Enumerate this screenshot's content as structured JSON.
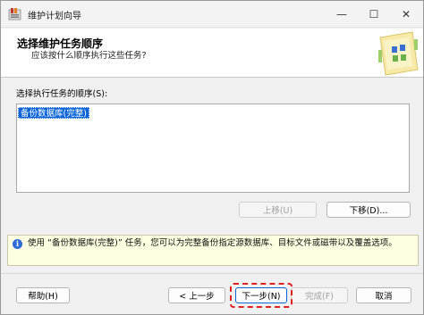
{
  "window": {
    "title": "维护计划向导",
    "minimize_glyph": "—",
    "maximize_glyph": "☐",
    "close_glyph": "✕"
  },
  "header": {
    "title": "选择维护任务顺序",
    "subtitle": "应该按什么顺序执行这些任务?"
  },
  "task_list": {
    "label": "选择执行任务的顺序(S):",
    "items": [
      "备份数据库(完整)"
    ],
    "selected_index": 0
  },
  "order_buttons": {
    "move_up": "上移(U)",
    "move_down": "下移(D)..."
  },
  "hint": {
    "icon": "info-icon",
    "text": "使用 “备份数据库(完整)” 任务，您可以为完整备份指定源数据库、目标文件或磁带以及覆盖选项。"
  },
  "footer": {
    "help": "帮助(H)",
    "back": "< 上一步",
    "next": "下一步(N)",
    "finish": "完成(F)",
    "cancel": "取消"
  },
  "colors": {
    "selection": "#0a64d8",
    "hint_background": "#ffffe1",
    "highlight_outline": "#e01f1f"
  }
}
